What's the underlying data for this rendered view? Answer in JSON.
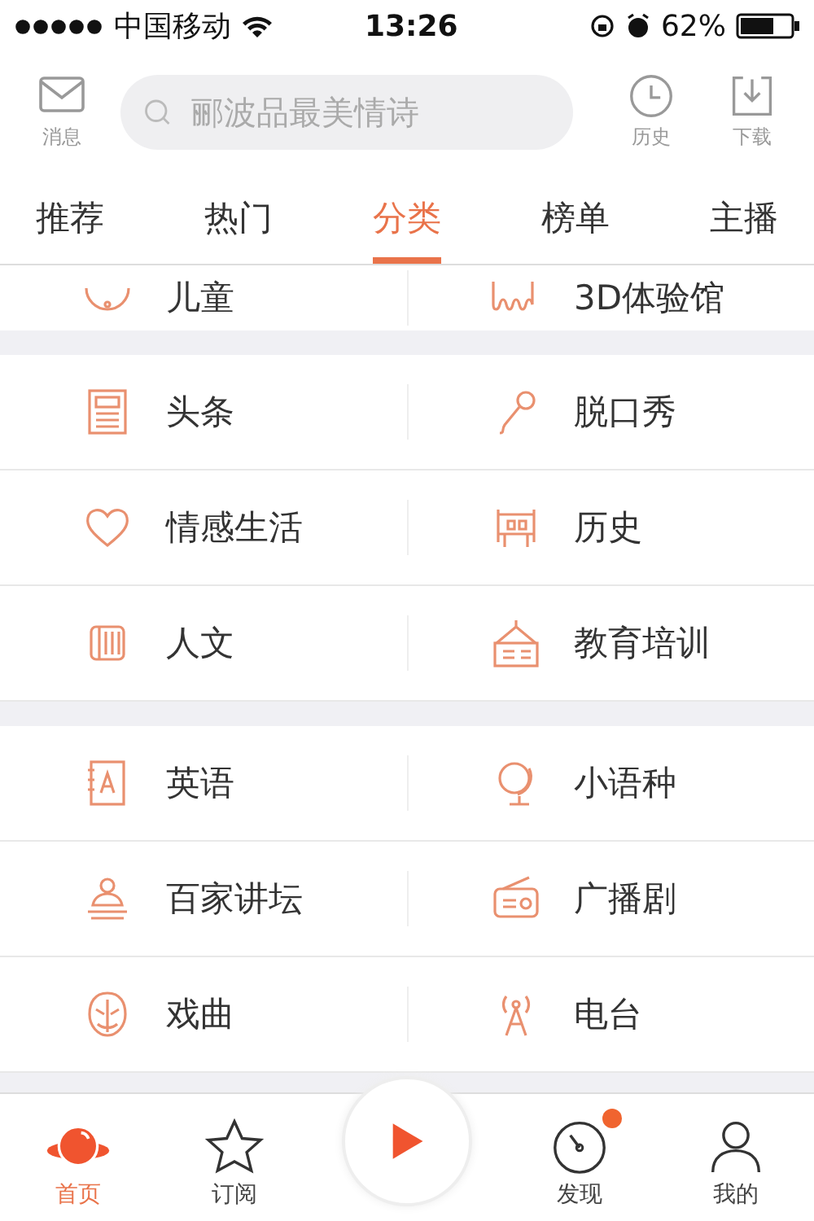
{
  "status_bar": {
    "carrier": "中国移动",
    "time": "13:26",
    "battery_text": "62%"
  },
  "header": {
    "left": {
      "label": "消息"
    },
    "search": {
      "placeholder": "郦波品最美情诗"
    },
    "right": [
      {
        "label": "历史"
      },
      {
        "label": "下载"
      }
    ]
  },
  "tabs": [
    {
      "label": "推荐",
      "selected": false
    },
    {
      "label": "热门",
      "selected": false
    },
    {
      "label": "分类",
      "selected": true
    },
    {
      "label": "榜单",
      "selected": false
    },
    {
      "label": "主播",
      "selected": false
    }
  ],
  "partial_row": [
    "儿童",
    "3D体验馆"
  ],
  "sections": [
    {
      "rows": [
        [
          "头条",
          "脱口秀"
        ],
        [
          "情感生活",
          "历史"
        ],
        [
          "人文",
          "教育培训"
        ]
      ]
    },
    {
      "rows": [
        [
          "英语",
          "小语种"
        ],
        [
          "百家讲坛",
          "广播剧"
        ],
        [
          "戏曲",
          "电台"
        ]
      ]
    }
  ],
  "tab_bar": [
    {
      "label": "首页",
      "selected": true,
      "badge": false
    },
    {
      "label": "订阅",
      "selected": false,
      "badge": false
    },
    {
      "label": "发现",
      "selected": false,
      "badge": true
    },
    {
      "label": "我的",
      "selected": false,
      "badge": false
    }
  ]
}
